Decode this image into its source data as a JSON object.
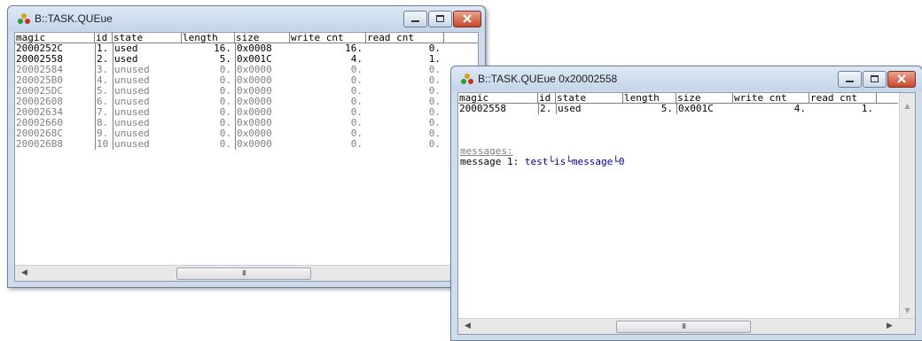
{
  "colors": {
    "used": "#000000",
    "unused": "#808080",
    "message_text": "#00008b"
  },
  "icons": {
    "window": "task-window-icon",
    "minimize": "minimize-icon",
    "maximize": "maximize-icon",
    "close": "close-icon"
  },
  "queue_window": {
    "title": "B::TASK.QUEue",
    "headers": [
      "magic",
      "id",
      "state",
      "length",
      "size",
      "write_cnt",
      "read_cnt"
    ],
    "rows": [
      {
        "magic": "2000252C",
        "id": "1.",
        "state": "used",
        "length": "16.",
        "size": "0x0008",
        "write_cnt": "16.",
        "read_cnt": "0."
      },
      {
        "magic": "20002558",
        "id": "2.",
        "state": "used",
        "length": "5.",
        "size": "0x001C",
        "write_cnt": "4.",
        "read_cnt": "1."
      },
      {
        "magic": "20002584",
        "id": "3.",
        "state": "unused",
        "length": "0.",
        "size": "0x0000",
        "write_cnt": "0.",
        "read_cnt": "0."
      },
      {
        "magic": "200025B0",
        "id": "4.",
        "state": "unused",
        "length": "0.",
        "size": "0x0000",
        "write_cnt": "0.",
        "read_cnt": "0."
      },
      {
        "magic": "200025DC",
        "id": "5.",
        "state": "unused",
        "length": "0.",
        "size": "0x0000",
        "write_cnt": "0.",
        "read_cnt": "0."
      },
      {
        "magic": "20002608",
        "id": "6.",
        "state": "unused",
        "length": "0.",
        "size": "0x0000",
        "write_cnt": "0.",
        "read_cnt": "0."
      },
      {
        "magic": "20002634",
        "id": "7.",
        "state": "unused",
        "length": "0.",
        "size": "0x0000",
        "write_cnt": "0.",
        "read_cnt": "0."
      },
      {
        "magic": "20002660",
        "id": "8.",
        "state": "unused",
        "length": "0.",
        "size": "0x0000",
        "write_cnt": "0.",
        "read_cnt": "0."
      },
      {
        "magic": "2000268C",
        "id": "9.",
        "state": "unused",
        "length": "0.",
        "size": "0x0000",
        "write_cnt": "0.",
        "read_cnt": "0."
      },
      {
        "magic": "200026B8",
        "id": "10",
        "state": "unused",
        "length": "0.",
        "size": "0x0000",
        "write_cnt": "0.",
        "read_cnt": "0."
      }
    ],
    "scroll_grip": "III"
  },
  "detail_window": {
    "title": "B::TASK.QUEue 0x20002558",
    "headers": [
      "magic",
      "id",
      "state",
      "length",
      "size",
      "write_cnt",
      "read_cnt"
    ],
    "row": {
      "magic": "20002558",
      "id": "2.",
      "state": "used",
      "length": "5.",
      "size": "0x001C",
      "write_cnt": "4.",
      "read_cnt": "1."
    },
    "messages_heading": "messages:",
    "message_label": "message 1:",
    "message_value": "test└is└message└0",
    "scroll_grip": "III"
  }
}
